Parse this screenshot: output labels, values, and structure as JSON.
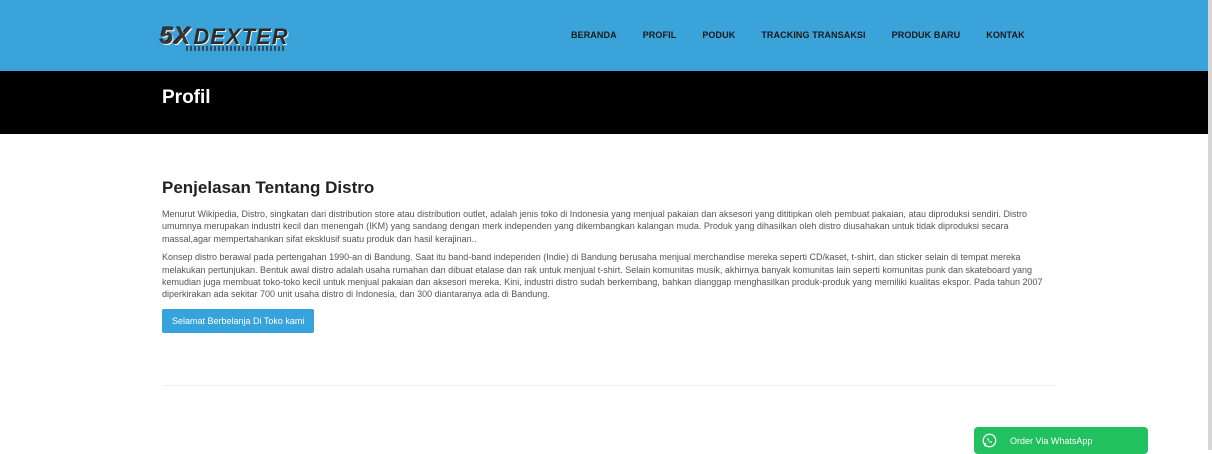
{
  "brand": {
    "logo_mark": "5X",
    "logo_text": "DEXTER"
  },
  "nav": [
    "BERANDA",
    "PROFIL",
    "PODUK",
    "TRACKING TRANSAKSI",
    "PRODUK BARU",
    "KONTAK"
  ],
  "page": {
    "title": "Profil"
  },
  "article": {
    "heading": "Penjelasan Tentang Distro",
    "paragraphs": [
      "Menurut Wikipedia, Distro, singkatan dari distribution store atau distribution outlet, adalah jenis toko di Indonesia yang menjual pakaian dan aksesori yang dititipkan oleh pembuat pakaian, atau diproduksi sendiri. Distro umumnya merupakan industri kecil dan menengah (IKM) yang sandang dengan merk independen yang dikembangkan kalangan muda. Produk yang dihasilkan oleh distro diusahakan untuk tidak diproduksi secara massal,agar mempertahankan sifat eksklusif suatu produk dan hasil kerajinan..",
      "Konsep distro berawal pada pertengahan 1990-an di Bandung. Saat itu band-band independen (Indie) di Bandung berusaha menjual merchandise mereka seperti CD/kaset, t-shirt, dan sticker selain di tempat mereka melakukan pertunjukan. Bentuk awal distro adalah usaha rumahan dan dibuat etalase dan rak untuk menjual t-shirt. Selain komunitas musik, akhirnya banyak komunitas lain seperti komunitas punk dan skateboard yang kemudian juga membuat toko-toko kecil untuk menjual pakaian dan aksesori mereka. Kini, industri distro sudah berkembang, bahkan dianggap menghasilkan produk-produk yang memiliki kualitas ekspor. Pada tahun 2007 diperkirakan ada sekitar 700 unit usaha distro di Indonesia, dan 300 diantaranya ada di Bandung."
    ],
    "cta_label": "Selamat Berbelanja Di Toko kami"
  },
  "whatsapp": {
    "label": "Order Via WhatsApp",
    "icon": "whatsapp-icon"
  },
  "colors": {
    "nav_bg": "#3aa3d9",
    "title_bg": "#000000",
    "button": "#36a3dc",
    "whatsapp": "#21c15f"
  }
}
